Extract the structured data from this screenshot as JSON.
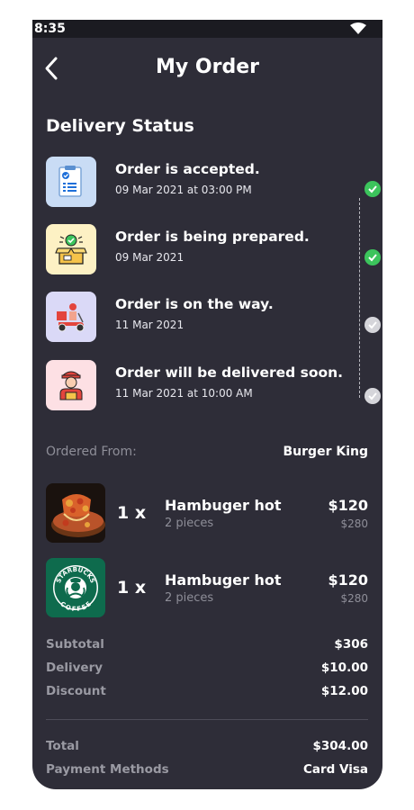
{
  "status_bar": {
    "time": "8:35",
    "wifi_icon": "wifi-icon"
  },
  "header": {
    "title": "My Order",
    "back_icon": "chevron-left-icon"
  },
  "delivery": {
    "title": "Delivery Status",
    "steps": [
      {
        "title": "Order is accepted.",
        "time": "09 Mar 2021 at 03:00 PM",
        "icon": "clipboard-check-icon",
        "done": true
      },
      {
        "title": "Order is being prepared.",
        "time": "09 Mar 2021",
        "icon": "box-icon",
        "done": true
      },
      {
        "title": "Order is on the way.",
        "time": "11 Mar 2021",
        "icon": "scooter-icon",
        "done": false
      },
      {
        "title": "Order will be delivered soon.",
        "time": "11 Mar 2021 at 10:00 AM",
        "icon": "courier-icon",
        "done": false
      }
    ]
  },
  "ordered_from": {
    "label": "Ordered From:",
    "value": "Burger King"
  },
  "items": [
    {
      "qty": "1 x",
      "name": "Hambuger hot",
      "sub": "2 pieces",
      "price": "$120",
      "old_price": "$280",
      "thumb": "pizza-image"
    },
    {
      "qty": "1 x",
      "name": "Hambuger hot",
      "sub": "2 pieces",
      "price": "$120",
      "old_price": "$280",
      "thumb": "starbucks-logo"
    }
  ],
  "summary": {
    "subtotal_label": "Subtotal",
    "subtotal": "$306",
    "delivery_label": "Delivery",
    "delivery": "$10.00",
    "discount_label": "Discount",
    "discount": "$12.00",
    "total_label": "Total",
    "total": "$304.00",
    "payment_label": "Payment Methods",
    "payment": "Card Visa"
  },
  "logo_text": {
    "top": "STARBUCKS",
    "bottom": "COFFEE"
  },
  "colors": {
    "background": "#2e2d38",
    "check_done": "#3cc45c",
    "check_pending": "#d5d5da",
    "starbucks_green": "#0e6b4d"
  }
}
